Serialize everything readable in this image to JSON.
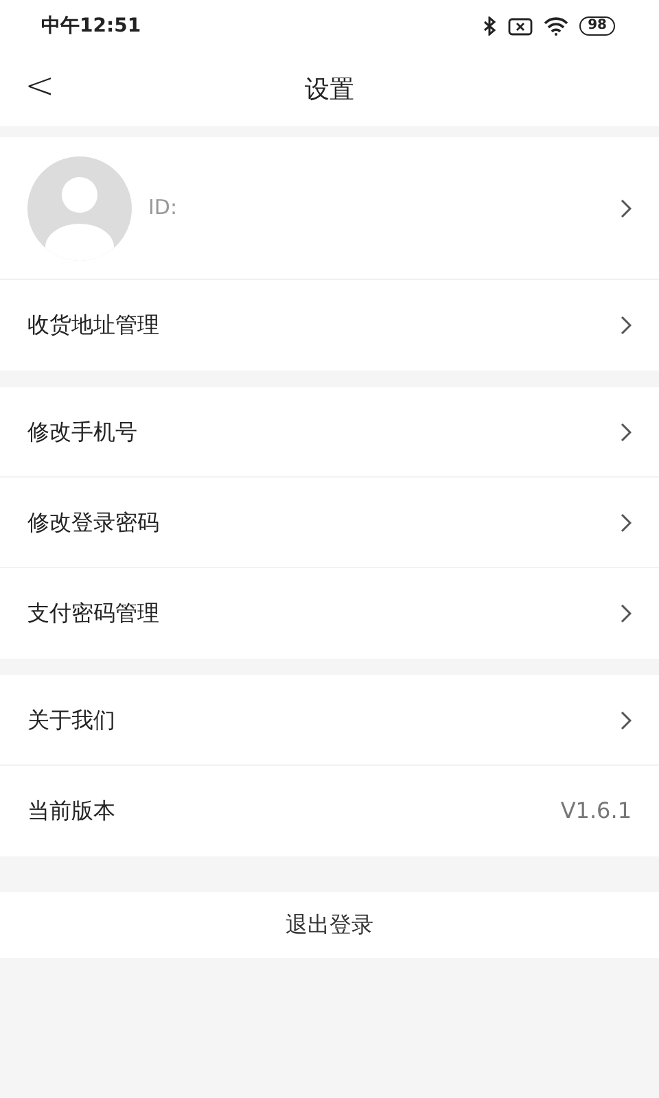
{
  "status_bar": {
    "time": "中午12:51",
    "battery": "98"
  },
  "header": {
    "back": "<",
    "title": "设置"
  },
  "profile": {
    "id_label": "ID:"
  },
  "groups": [
    {
      "rows": [
        {
          "kind": "link",
          "label": "收货地址管理"
        }
      ]
    },
    {
      "rows": [
        {
          "kind": "link",
          "label": "修改手机号"
        },
        {
          "kind": "link",
          "label": "修改登录密码"
        },
        {
          "kind": "link",
          "label": "支付密码管理"
        }
      ]
    },
    {
      "rows": [
        {
          "kind": "link",
          "label": "关于我们"
        },
        {
          "kind": "value",
          "label": "当前版本",
          "value": "V1.6.1"
        }
      ]
    }
  ],
  "logout": {
    "label": "退出登录"
  }
}
